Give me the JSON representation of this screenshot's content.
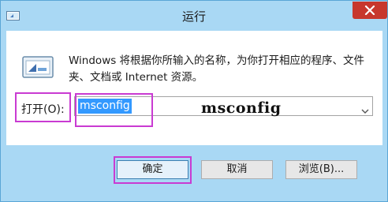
{
  "window": {
    "title": "运行"
  },
  "content": {
    "description": "Windows 将根据你所输入的名称，为你打开相应的程序、文件夹、文档或 Internet 资源。",
    "open_label": "打开(O):",
    "command_value": "msconfig",
    "overlay_text": "msconfig"
  },
  "buttons": {
    "ok": "确定",
    "cancel": "取消",
    "browse": "浏览(B)..."
  },
  "icons": {
    "system_menu": "run-app-icon",
    "close": "close-icon",
    "run": "run-program-icon",
    "dropdown": "chevron-down-icon"
  },
  "colors": {
    "frame": "#a9d8f4",
    "close": "#c7372d",
    "selection": "#3399ff",
    "highlight": "#c93bd2"
  }
}
